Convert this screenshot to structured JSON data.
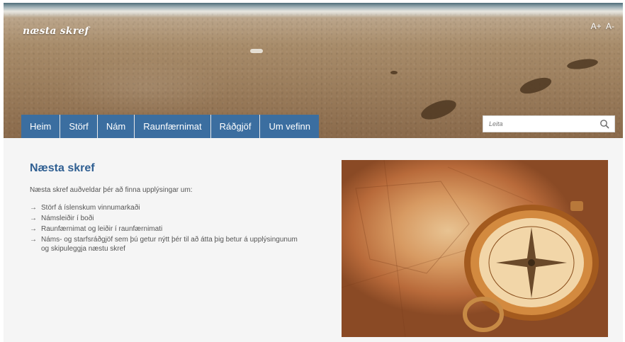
{
  "site": {
    "logo_text": "næsta skref"
  },
  "font_controls": {
    "increase": "A+",
    "decrease": "A-"
  },
  "nav": {
    "items": [
      "Heim",
      "Störf",
      "Nám",
      "Raunfærnimat",
      "Ráðgjöf",
      "Um vefinn"
    ]
  },
  "search": {
    "placeholder": "Leita"
  },
  "main": {
    "title": "Næsta skref",
    "intro": "Næsta skref auðveldar þér að finna upplýsingar um:",
    "list_items": [
      "Störf á íslenskum vinnumarkaði",
      "Námsleiðir í boði",
      "Raunfærnimat og leiðir í raunfærnimati",
      "Náms- og starfsráðgjöf sem þú getur nýtt þér til að átta þig betur á upplýsingunum og skipuleggja næstu skref"
    ],
    "list_arrow": "→"
  },
  "icons": {
    "search": "search-icon",
    "compass_image": "compass-image"
  },
  "colors": {
    "nav_bg": "#3b6ea0",
    "heading": "#2f5f92",
    "content_bg": "#f5f5f5"
  }
}
